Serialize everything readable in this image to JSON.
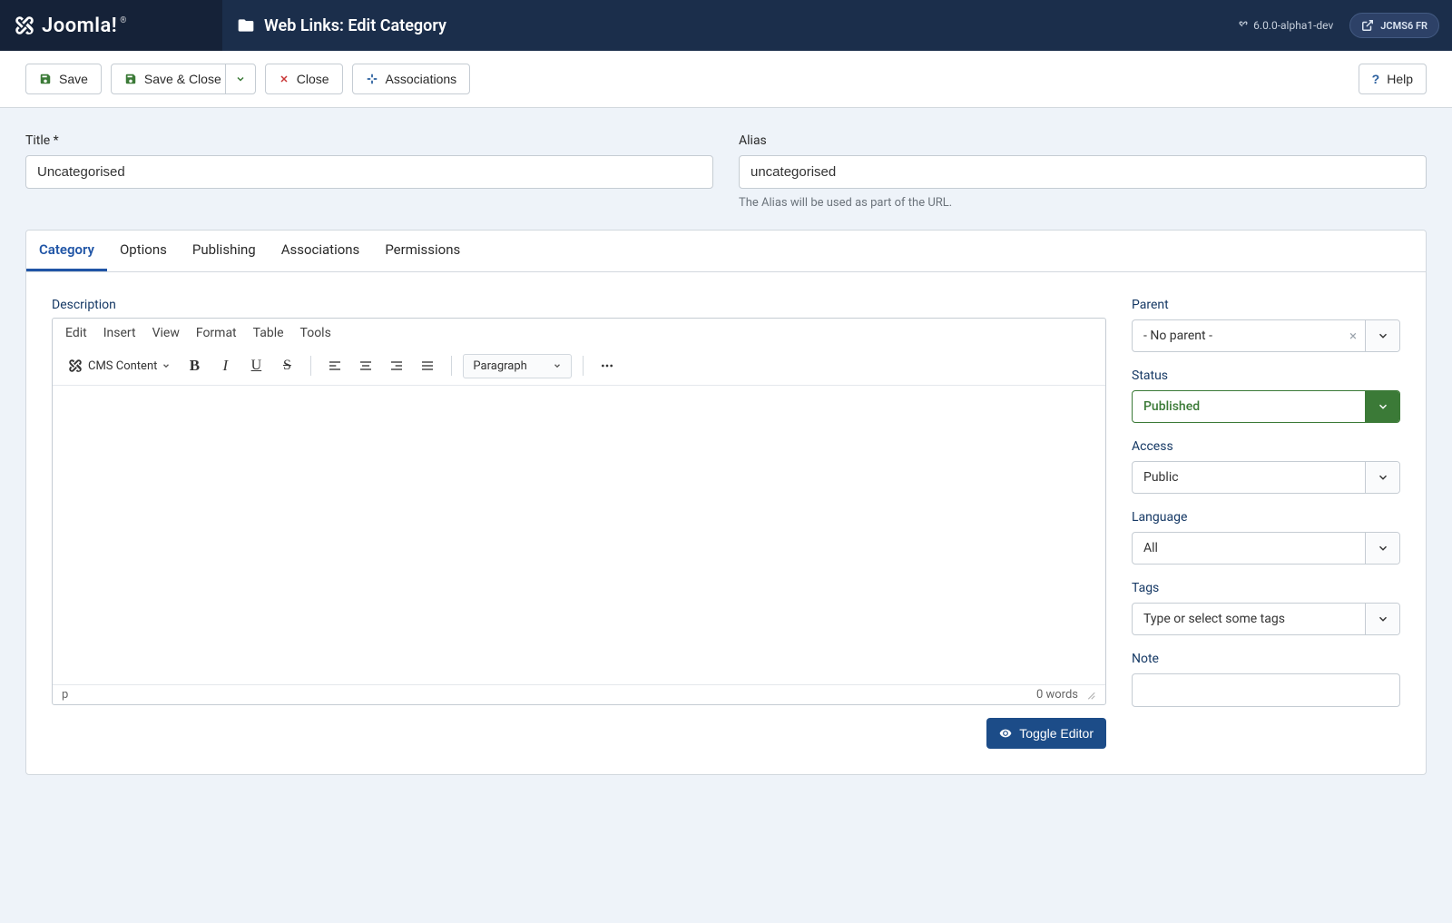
{
  "brand": "Joomla!",
  "page_title": "Web Links: Edit Category",
  "version": "6.0.0-alpha1-dev",
  "site_badge": "JCMS6 FR",
  "toolbar": {
    "save": "Save",
    "save_close": "Save & Close",
    "close": "Close",
    "associations": "Associations",
    "help": "Help"
  },
  "fields": {
    "title_label": "Title *",
    "title_value": "Uncategorised",
    "alias_label": "Alias",
    "alias_value": "uncategorised",
    "alias_hint": "The Alias will be used as part of the URL."
  },
  "tabs": [
    "Category",
    "Options",
    "Publishing",
    "Associations",
    "Permissions"
  ],
  "active_tab": 0,
  "editor": {
    "description_label": "Description",
    "menu": [
      "Edit",
      "Insert",
      "View",
      "Format",
      "Table",
      "Tools"
    ],
    "cms_content": "CMS Content",
    "paragraph": "Paragraph",
    "path": "p",
    "words": "0 words",
    "toggle": "Toggle Editor"
  },
  "sidebar": {
    "parent": {
      "label": "Parent",
      "value": "- No parent -"
    },
    "status": {
      "label": "Status",
      "value": "Published"
    },
    "access": {
      "label": "Access",
      "value": "Public"
    },
    "language": {
      "label": "Language",
      "value": "All"
    },
    "tags": {
      "label": "Tags",
      "placeholder": "Type or select some tags"
    },
    "note": {
      "label": "Note",
      "value": ""
    }
  }
}
